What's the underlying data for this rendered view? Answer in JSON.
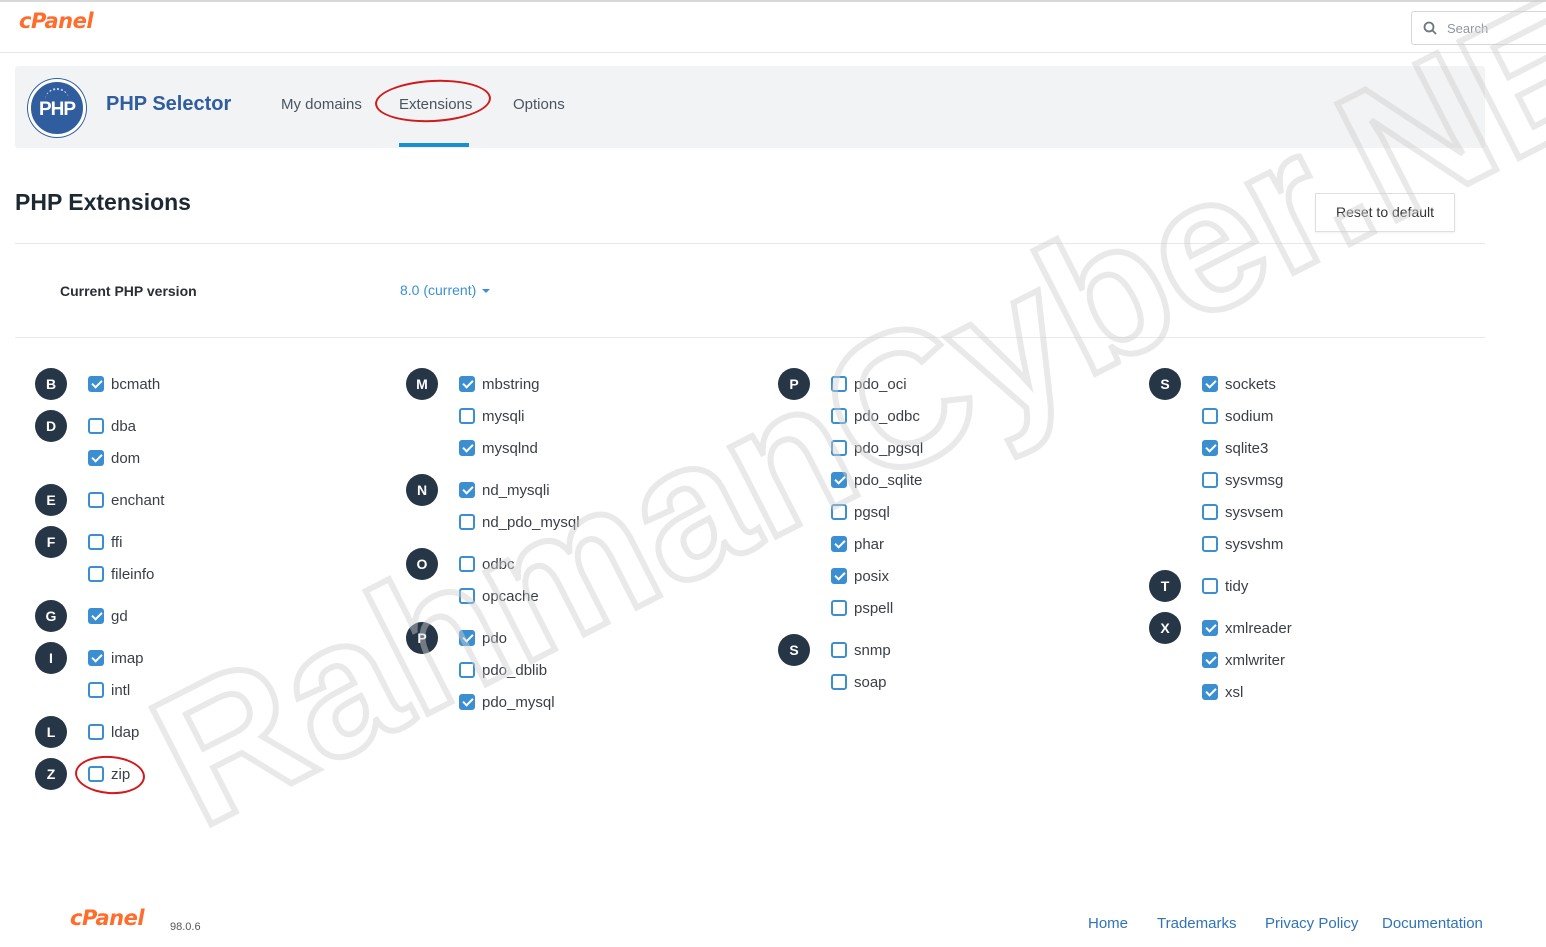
{
  "topbar": {
    "logo": "cPanel",
    "search_placeholder": "Search"
  },
  "app": {
    "icon_text": "PHP",
    "title": "PHP Selector",
    "tabs": [
      {
        "label": "My domains"
      },
      {
        "label": "Extensions"
      },
      {
        "label": "Options"
      }
    ],
    "active_tab": "Extensions"
  },
  "page": {
    "title": "PHP Extensions",
    "reset_label": "Reset to default",
    "version_label": "Current PHP version",
    "version_value": "8.0 (current)"
  },
  "groups": [
    {
      "letter": "B",
      "items": [
        {
          "name": "bcmath",
          "checked": true
        }
      ]
    },
    {
      "letter": "D",
      "items": [
        {
          "name": "dba",
          "checked": false
        },
        {
          "name": "dom",
          "checked": true
        }
      ]
    },
    {
      "letter": "E",
      "items": [
        {
          "name": "enchant",
          "checked": false
        }
      ]
    },
    {
      "letter": "F",
      "items": [
        {
          "name": "ffi",
          "checked": false
        },
        {
          "name": "fileinfo",
          "checked": false
        }
      ]
    },
    {
      "letter": "G",
      "items": [
        {
          "name": "gd",
          "checked": true
        }
      ]
    },
    {
      "letter": "I",
      "items": [
        {
          "name": "imap",
          "checked": true
        },
        {
          "name": "intl",
          "checked": false
        }
      ]
    },
    {
      "letter": "L",
      "items": [
        {
          "name": "ldap",
          "checked": false
        }
      ]
    },
    {
      "letter": "Z",
      "items": [
        {
          "name": "zip",
          "checked": false
        }
      ]
    },
    {
      "letter": "M",
      "items": [
        {
          "name": "mbstring",
          "checked": true
        },
        {
          "name": "mysqli",
          "checked": false
        },
        {
          "name": "mysqlnd",
          "checked": true
        }
      ]
    },
    {
      "letter": "N",
      "items": [
        {
          "name": "nd_mysqli",
          "checked": true
        },
        {
          "name": "nd_pdo_mysql",
          "checked": false
        }
      ]
    },
    {
      "letter": "O",
      "items": [
        {
          "name": "odbc",
          "checked": false
        },
        {
          "name": "opcache",
          "checked": false
        }
      ]
    },
    {
      "letter": "P",
      "items": [
        {
          "name": "pdo",
          "checked": true
        },
        {
          "name": "pdo_dblib",
          "checked": false
        },
        {
          "name": "pdo_mysql",
          "checked": true
        }
      ]
    },
    {
      "letter": "P",
      "items": [
        {
          "name": "pdo_oci",
          "checked": false
        },
        {
          "name": "pdo_odbc",
          "checked": false
        },
        {
          "name": "pdo_pgsql",
          "checked": false
        },
        {
          "name": "pdo_sqlite",
          "checked": true
        },
        {
          "name": "pgsql",
          "checked": false
        },
        {
          "name": "phar",
          "checked": true
        },
        {
          "name": "posix",
          "checked": true
        },
        {
          "name": "pspell",
          "checked": false
        }
      ]
    },
    {
      "letter": "S",
      "items": [
        {
          "name": "snmp",
          "checked": false
        },
        {
          "name": "soap",
          "checked": false
        }
      ]
    },
    {
      "letter": "S",
      "items": [
        {
          "name": "sockets",
          "checked": true
        },
        {
          "name": "sodium",
          "checked": false
        },
        {
          "name": "sqlite3",
          "checked": true
        },
        {
          "name": "sysvmsg",
          "checked": false
        },
        {
          "name": "sysvsem",
          "checked": false
        },
        {
          "name": "sysvshm",
          "checked": false
        }
      ]
    },
    {
      "letter": "T",
      "items": [
        {
          "name": "tidy",
          "checked": false
        }
      ]
    },
    {
      "letter": "X",
      "items": [
        {
          "name": "xmlreader",
          "checked": true
        },
        {
          "name": "xmlwriter",
          "checked": true
        },
        {
          "name": "xsl",
          "checked": true
        }
      ]
    }
  ],
  "watermark": "RahmanCyber.NET",
  "footer": {
    "logo": "cPanel",
    "version": "98.0.6",
    "links": [
      "Home",
      "Trademarks",
      "Privacy Policy",
      "Documentation"
    ]
  },
  "colors": {
    "accent": "#3b8fd0",
    "brand": "#ff6c2c",
    "annotation": "#d2191b",
    "letter_badge": "#263647"
  }
}
